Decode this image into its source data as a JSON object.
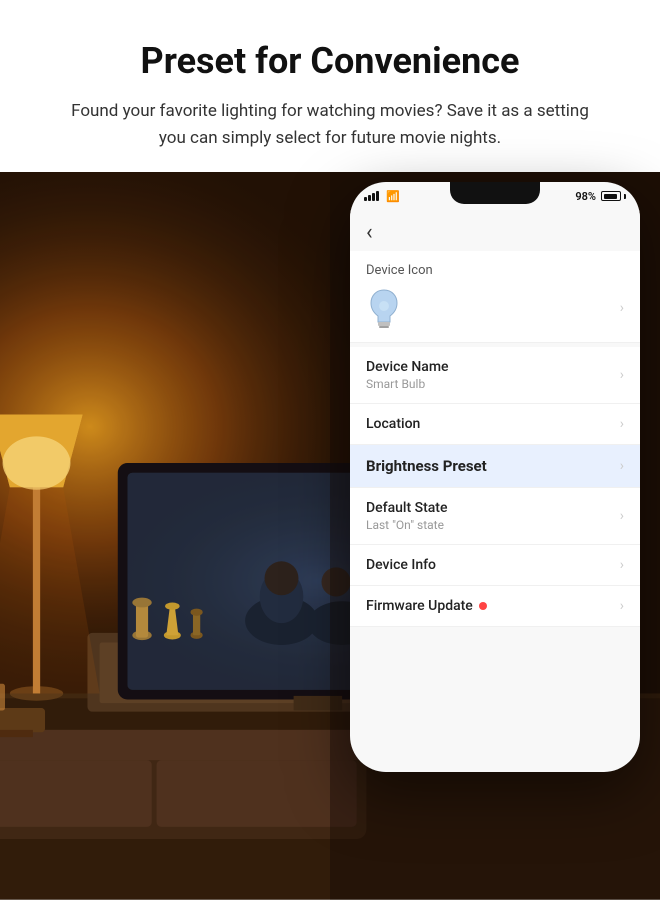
{
  "header": {
    "title": "Preset for Convenience",
    "subtitle": "Found your favorite lighting for watching movies? Save it as a setting you can simply select for future movie nights."
  },
  "status_bar": {
    "battery_percent": "98%"
  },
  "phone": {
    "nav": {
      "back_label": "‹"
    },
    "menu_items": [
      {
        "id": "device-icon",
        "label": "Device Icon",
        "type": "icon-section"
      },
      {
        "id": "device-name",
        "label": "Device Name",
        "subtitle": "Smart Bulb",
        "highlighted": false
      },
      {
        "id": "location",
        "label": "Location",
        "subtitle": "",
        "highlighted": false
      },
      {
        "id": "brightness-preset",
        "label": "Brightness Preset",
        "subtitle": "",
        "highlighted": true
      },
      {
        "id": "default-state",
        "label": "Default State",
        "subtitle": "Last \"On\" state",
        "highlighted": false
      },
      {
        "id": "device-info",
        "label": "Device Info",
        "subtitle": "",
        "highlighted": false
      },
      {
        "id": "firmware-update",
        "label": "Firmware Update",
        "subtitle": "",
        "highlighted": false,
        "has_dot": true
      }
    ]
  }
}
